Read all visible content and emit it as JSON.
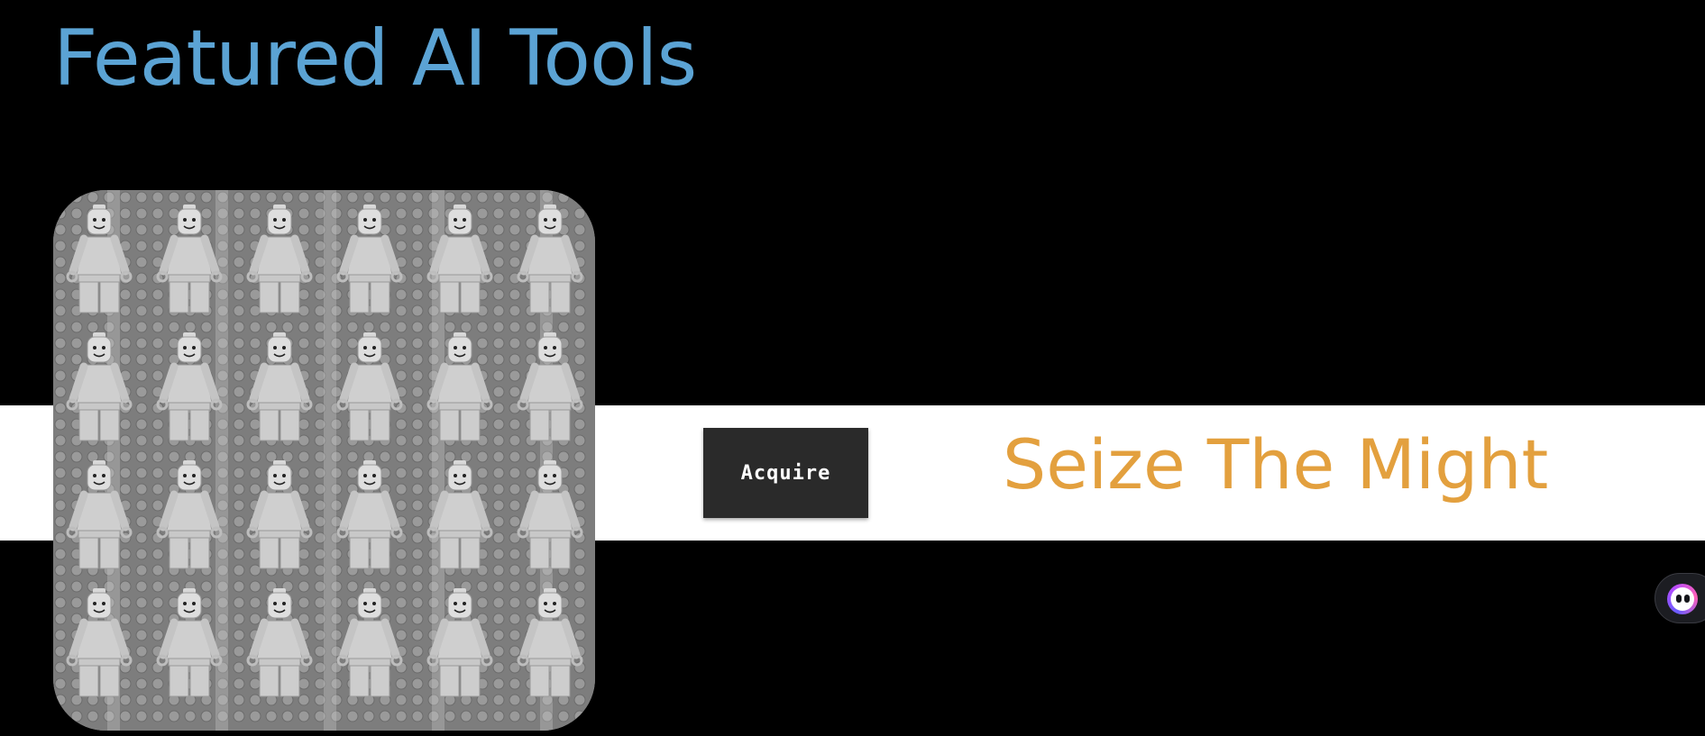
{
  "section": {
    "heading": "Featured AI Tools",
    "heading_color": "#5ba3d4"
  },
  "promo": {
    "image_alt": "grid of gray toy minifigures",
    "button_label": "Acquire",
    "tagline": "Seize The Might",
    "tagline_color": "#e3a03e",
    "band_color": "#ffffff"
  },
  "chat_widget": {
    "icon": "chat-bot-icon"
  }
}
